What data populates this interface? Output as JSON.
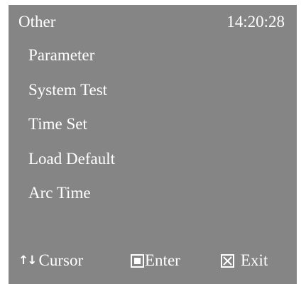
{
  "header": {
    "title": "Other",
    "time": "14:20:28"
  },
  "menu": {
    "items": [
      {
        "label": "Parameter"
      },
      {
        "label": "System Test"
      },
      {
        "label": "Time Set"
      },
      {
        "label": "Load Default"
      },
      {
        "label": "Arc Time"
      }
    ]
  },
  "footer": {
    "cursor_icon": "up-down-arrows-icon",
    "cursor_label": "Cursor",
    "enter_icon": "enter-key-icon",
    "enter_label": "Enter",
    "exit_icon": "close-box-icon",
    "exit_label": "Exit"
  },
  "colors": {
    "screen_background": "#858585",
    "text": "#ffffff"
  }
}
